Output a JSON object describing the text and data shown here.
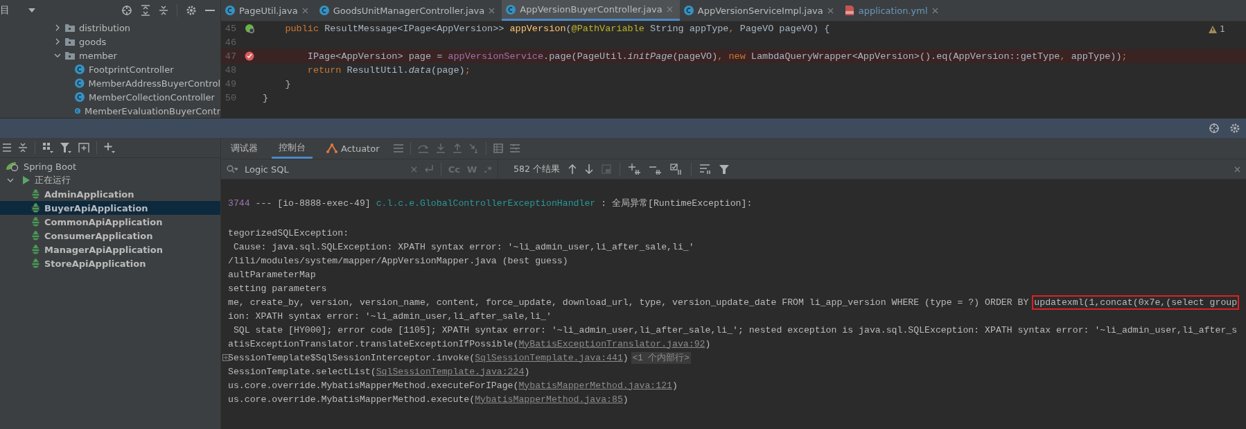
{
  "project_panel": {
    "title": "目",
    "tree": [
      {
        "label": "distribution",
        "kind": "folder",
        "expanded": false
      },
      {
        "label": "goods",
        "kind": "folder",
        "expanded": false
      },
      {
        "label": "member",
        "kind": "folder",
        "expanded": true,
        "children": [
          {
            "label": "FootprintController",
            "kind": "class"
          },
          {
            "label": "MemberAddressBuyerControl",
            "kind": "class"
          },
          {
            "label": "MemberCollectionController",
            "kind": "class"
          },
          {
            "label": "MemberEvaluationBuyerContr",
            "kind": "class"
          }
        ]
      }
    ]
  },
  "editor_tabs": [
    {
      "label": "PageUtil.java",
      "kind": "class",
      "selected": false
    },
    {
      "label": "GoodsUnitManagerController.java",
      "kind": "class",
      "selected": false
    },
    {
      "label": "AppVersionBuyerController.java",
      "kind": "class",
      "selected": true
    },
    {
      "label": "AppVersionServiceImpl.java",
      "kind": "class",
      "selected": false
    },
    {
      "label": "application.yml",
      "kind": "yml",
      "selected": false
    }
  ],
  "editor": {
    "warnings": "1",
    "lines": [
      {
        "number": "45",
        "kind": "bean",
        "highlighted": false,
        "segments": [
          {
            "kind": "keyword",
            "text": "    public "
          },
          {
            "kind": "plain",
            "text": "ResultMessage<IPage<AppVersion>> "
          },
          {
            "kind": "method",
            "text": "appVersion"
          },
          {
            "kind": "plain",
            "text": "("
          },
          {
            "kind": "annotation",
            "text": "@PathVariable "
          },
          {
            "kind": "plain",
            "text": "String appType"
          },
          {
            "kind": "keyword",
            "text": ", "
          },
          {
            "kind": "plain",
            "text": "PageVO pageVO) {"
          }
        ]
      },
      {
        "number": "46",
        "kind": "plain",
        "highlighted": false
      },
      {
        "number": "47",
        "kind": "breakpoint",
        "highlighted": true,
        "segments": [
          {
            "kind": "plain",
            "text": "        IPage<AppVersion> page = "
          },
          {
            "kind": "field",
            "text": "appVersionService"
          },
          {
            "kind": "plain",
            "text": ".page(PageUtil."
          },
          {
            "kind": "italic",
            "text": "initPage"
          },
          {
            "kind": "plain",
            "text": "(pageVO)"
          },
          {
            "kind": "keyword",
            "text": ", new "
          },
          {
            "kind": "plain",
            "text": "LambdaQueryWrapper<AppVersion>().eq(AppVersion::getType"
          },
          {
            "kind": "keyword",
            "text": ", "
          },
          {
            "kind": "plain",
            "text": "appType))"
          },
          {
            "kind": "keyword",
            "text": ";"
          }
        ]
      },
      {
        "number": "48",
        "kind": "plain",
        "highlighted": false,
        "segments": [
          {
            "kind": "keyword",
            "text": "        return "
          },
          {
            "kind": "plain",
            "text": "ResultUtil."
          },
          {
            "kind": "italic",
            "text": "data"
          },
          {
            "kind": "plain",
            "text": "(page)"
          },
          {
            "kind": "keyword",
            "text": ";"
          }
        ]
      },
      {
        "number": "49",
        "kind": "plain",
        "highlighted": false,
        "segments": [
          {
            "kind": "plain",
            "text": "    }"
          }
        ]
      },
      {
        "number": "50",
        "kind": "plain",
        "highlighted": false,
        "segments": [
          {
            "kind": "plain",
            "text": "}"
          }
        ]
      }
    ]
  },
  "services_panel": {
    "run_tree": {
      "root": "Spring Boot",
      "status": {
        "label": "正在运行",
        "expanded": true
      },
      "apps": [
        {
          "label": "AdminApplication",
          "selected": false
        },
        {
          "label": "BuyerApiApplication",
          "selected": true
        },
        {
          "label": "CommonApiApplication",
          "selected": false
        },
        {
          "label": "ConsumerApplication",
          "selected": false
        },
        {
          "label": "ManagerApiApplication",
          "selected": false
        },
        {
          "label": "StoreApiApplication",
          "selected": false
        }
      ]
    }
  },
  "console": {
    "tabs": [
      {
        "label": "调试器",
        "selected": false,
        "kind": "plain"
      },
      {
        "label": "控制台",
        "selected": true,
        "kind": "plain"
      },
      {
        "label": "Actuator",
        "selected": false,
        "kind": "actuator"
      }
    ],
    "search": {
      "value": "Logic SQL",
      "options": [
        "Cc",
        "W",
        ".*"
      ],
      "results": "582 个结果"
    },
    "lines": [
      {
        "fold": false,
        "segments": [
          {
            "kind": "number",
            "text": "3744"
          },
          {
            "kind": "plain",
            "text": " --- [io-8888-exec-49] "
          },
          {
            "kind": "class",
            "text": "c.l.c.e.GlobalControllerExceptionHandler"
          },
          {
            "kind": "plain",
            "text": " : 全局异常[RuntimeException]:"
          }
        ]
      },
      {
        "fold": false,
        "segments": [
          {
            "kind": "plain",
            "text": "tegorizedSQLException:"
          }
        ]
      },
      {
        "fold": false,
        "segments": [
          {
            "kind": "plain",
            "text": " Cause: java.sql.SQLException: XPATH syntax error: '~li_admin_user,li_after_sale,li_'"
          }
        ]
      },
      {
        "fold": false,
        "segments": [
          {
            "kind": "plain",
            "text": "/lili/modules/system/mapper/AppVersionMapper.java (best guess)"
          }
        ]
      },
      {
        "fold": false,
        "segments": [
          {
            "kind": "plain",
            "text": "aultParameterMap"
          }
        ]
      },
      {
        "fold": false,
        "segments": [
          {
            "kind": "plain",
            "text": "setting parameters"
          }
        ]
      },
      {
        "fold": false,
        "segments": [
          {
            "kind": "plain",
            "text": "me, create_by, version, version_name, content, force_update, download_url, type, version_update_date FROM li_app_version WHERE (type = ?) ORDER BY "
          },
          {
            "kind": "boxed",
            "text": "updatexml(1,concat(0x7e,(select group"
          }
        ]
      },
      {
        "fold": false,
        "segments": [
          {
            "kind": "plain",
            "text": "ion: XPATH syntax error: '~li_admin_user,li_after_sale,li_'"
          }
        ]
      },
      {
        "fold": false,
        "segments": [
          {
            "kind": "plain",
            "text": " SQL state [HY000]; error code [1105]; XPATH syntax error: '~li_admin_user,li_after_sale,li_'; nested exception is java.sql.SQLException: XPATH syntax error: '~li_admin_user,li_after_s"
          }
        ]
      },
      {
        "fold": false,
        "segments": [
          {
            "kind": "plain",
            "text": "atisExceptionTranslator.translateExceptionIfPossible("
          },
          {
            "kind": "link",
            "text": "MyBatisExceptionTranslator.java:92"
          },
          {
            "kind": "plain",
            "text": ")"
          }
        ]
      },
      {
        "fold": true,
        "segments": [
          {
            "kind": "plain",
            "text": "SessionTemplate$SqlSessionInterceptor.invoke("
          },
          {
            "kind": "link",
            "text": "SqlSessionTemplate.java:441"
          },
          {
            "kind": "plain",
            "text": ")"
          },
          {
            "kind": "hint",
            "text": "<1 个内部行>"
          }
        ]
      },
      {
        "fold": false,
        "segments": [
          {
            "kind": "plain",
            "text": "SessionTemplate.selectList("
          },
          {
            "kind": "link",
            "text": "SqlSessionTemplate.java:224"
          },
          {
            "kind": "plain",
            "text": ")"
          }
        ]
      },
      {
        "fold": false,
        "segments": [
          {
            "kind": "plain",
            "text": "us.core.override.MybatisMapperMethod.executeForIPage("
          },
          {
            "kind": "link",
            "text": "MybatisMapperMethod.java:121"
          },
          {
            "kind": "plain",
            "text": ")"
          }
        ]
      },
      {
        "fold": false,
        "segments": [
          {
            "kind": "plain",
            "text": "us.core.override.MybatisMapperMethod.execute("
          },
          {
            "kind": "link",
            "text": "MybatisMapperMethod.java:85"
          },
          {
            "kind": "plain",
            "text": ")"
          }
        ]
      }
    ]
  }
}
